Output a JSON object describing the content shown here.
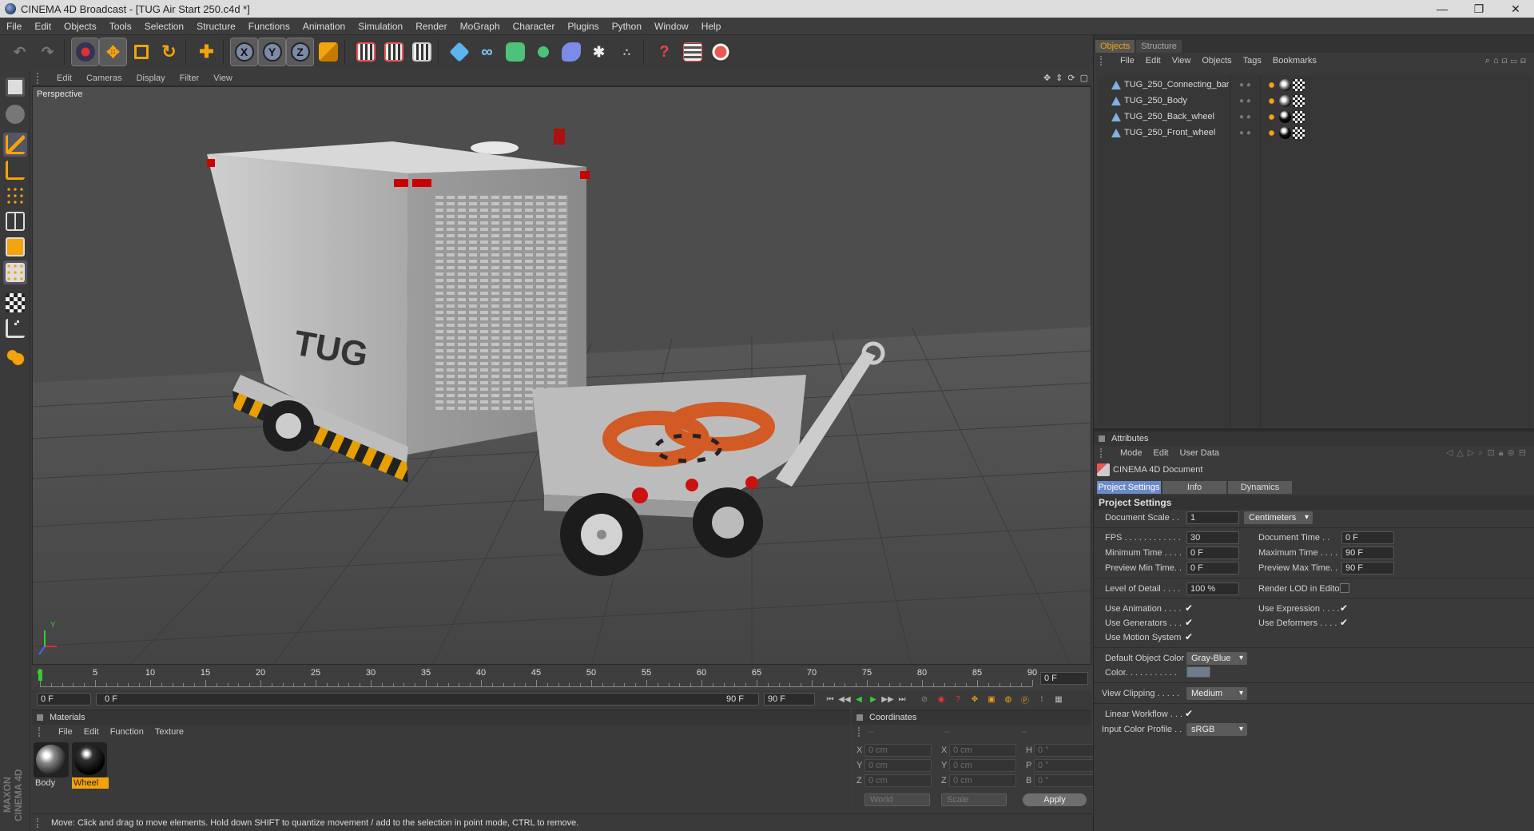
{
  "window": {
    "title": "CINEMA 4D Broadcast - [TUG Air Start 250.c4d *]",
    "minimize": "—",
    "maximize": "❐",
    "close": "✕"
  },
  "menu": [
    "File",
    "Edit",
    "Objects",
    "Tools",
    "Selection",
    "Structure",
    "Functions",
    "Animation",
    "Simulation",
    "Render",
    "MoGraph",
    "Character",
    "Plugins",
    "Python",
    "Window",
    "Help"
  ],
  "toolbar": {
    "x_axis": "X",
    "y_axis": "Y",
    "z_axis": "Z",
    "icons": [
      "undo-icon",
      "redo-icon",
      "live-select-icon",
      "move-icon",
      "scale-icon",
      "rotate-icon",
      "add-icon",
      "x-axis-icon",
      "y-axis-icon",
      "z-axis-icon",
      "coordinate-system-icon",
      "render-view-icon",
      "render-picture-viewer-icon",
      "edit-render-settings-icon",
      "cube-icon",
      "spline-icon",
      "nurbs-icon",
      "array-icon",
      "deformer-icon",
      "scene-icon",
      "particle-icon",
      "help-icon",
      "timeline-icon",
      "web-icon"
    ]
  },
  "viewport": {
    "menu": [
      "Edit",
      "Cameras",
      "Display",
      "Filter",
      "View"
    ],
    "label": "Perspective",
    "axis_y": "Y",
    "decal": "TUG"
  },
  "timeline": {
    "ticks": [
      "0",
      "5",
      "10",
      "15",
      "20",
      "25",
      "30",
      "35",
      "40",
      "45",
      "50",
      "55",
      "60",
      "65",
      "70",
      "75",
      "80",
      "85",
      "90"
    ],
    "current_frame": "0 F"
  },
  "transport": {
    "start": "0 F",
    "range_start": "0 F",
    "range_end": "90 F",
    "end": "90 F"
  },
  "materials": {
    "title": "Materials",
    "menu": [
      "File",
      "Edit",
      "Function",
      "Texture"
    ],
    "items": [
      {
        "name": "Body",
        "selected": false
      },
      {
        "name": "Wheel",
        "selected": true
      }
    ]
  },
  "coordinates": {
    "title": "Coordinates",
    "headers": [
      "--",
      "--",
      "--"
    ],
    "rows": [
      {
        "a": "X",
        "av": "0 cm",
        "b": "X",
        "bv": "0 cm",
        "c": "H",
        "cv": "0 °"
      },
      {
        "a": "Y",
        "av": "0 cm",
        "b": "Y",
        "bv": "0 cm",
        "c": "P",
        "cv": "0 °"
      },
      {
        "a": "Z",
        "av": "0 cm",
        "b": "Z",
        "bv": "0 cm",
        "c": "B",
        "cv": "0 °"
      }
    ],
    "world": "World",
    "scale": "Scale",
    "apply": "Apply"
  },
  "status": "Move: Click and drag to move elements. Hold down SHIFT to quantize movement / add to the selection in point mode, CTRL to remove.",
  "maxon": "MAXON CINEMA 4D",
  "objects_panel": {
    "tabs": [
      "Objects",
      "Structure"
    ],
    "menu": [
      "File",
      "Edit",
      "View",
      "Objects",
      "Tags",
      "Bookmarks"
    ],
    "items": [
      "TUG_250_Connecting_bar",
      "TUG_250_Body",
      "TUG_250_Back_wheel",
      "TUG_250_Front_wheel"
    ]
  },
  "attributes": {
    "title": "Attributes",
    "menu": [
      "Mode",
      "Edit",
      "User Data"
    ],
    "doc_label": "CINEMA 4D Document",
    "tabs": [
      "Project Settings",
      "Info",
      "Dynamics"
    ],
    "section": "Project Settings",
    "document_scale_label": "Document Scale . .",
    "document_scale": "1",
    "document_scale_unit": "Centimeters",
    "fps_label": "FPS . . . . . . . . . . . .",
    "fps": "30",
    "document_time_label": "Document Time . .",
    "document_time": "0 F",
    "min_time_label": "Minimum Time . . . .",
    "min_time": "0 F",
    "max_time_label": "Maximum Time . . . .",
    "max_time": "90 F",
    "preview_min_label": "Preview Min Time. .",
    "preview_min": "0 F",
    "preview_max_label": "Preview Max Time. .",
    "preview_max": "90 F",
    "lod_label": "Level of Detail . . . .",
    "lod": "100 %",
    "render_lod_label": "Render LOD in Editor",
    "use_animation_label": "Use Animation . . . .",
    "use_expression_label": "Use Expression . . . .",
    "use_generators_label": "Use Generators . . .",
    "use_deformers_label": "Use Deformers . . . .",
    "use_motion_label": "Use Motion System",
    "check": "✔",
    "default_color_label": "Default Object Color",
    "default_color": "Gray-Blue",
    "color_label": "Color. . . . . . . . . . .",
    "view_clipping_label": "View Clipping . . . . .",
    "view_clipping": "Medium",
    "linear_workflow_label": "Linear Workflow . . .",
    "input_profile_label": "Input Color Profile . .",
    "input_profile": "sRGB"
  },
  "colors": {
    "accent": "#f4a30a",
    "viewport_bg": "#4d4d4d",
    "panel_bg": "#3a3a3a",
    "tab_active": "#6a8ac8"
  }
}
